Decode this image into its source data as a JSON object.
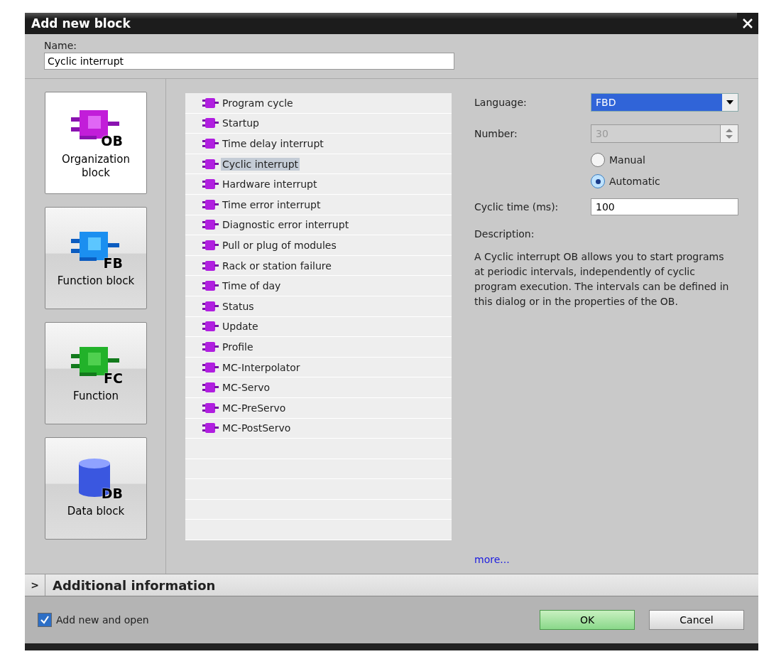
{
  "window": {
    "title": "Add new block"
  },
  "name_field": {
    "label": "Name:",
    "value": "Cyclic interrupt"
  },
  "block_types": [
    {
      "kind": "ob",
      "icon_label": "OB",
      "label": "Organization block",
      "selected": true
    },
    {
      "kind": "fb",
      "icon_label": "FB",
      "label": "Function block",
      "selected": false
    },
    {
      "kind": "fc",
      "icon_label": "FC",
      "label": "Function",
      "selected": false
    },
    {
      "kind": "db",
      "icon_label": "DB",
      "label": "Data block",
      "selected": false
    }
  ],
  "ob_types": [
    {
      "label": "Program cycle",
      "selected": false
    },
    {
      "label": "Startup",
      "selected": false
    },
    {
      "label": "Time delay interrupt",
      "selected": false
    },
    {
      "label": "Cyclic interrupt",
      "selected": true
    },
    {
      "label": "Hardware interrupt",
      "selected": false
    },
    {
      "label": "Time error interrupt",
      "selected": false
    },
    {
      "label": "Diagnostic error interrupt",
      "selected": false
    },
    {
      "label": "Pull or plug of modules",
      "selected": false
    },
    {
      "label": "Rack or station failure",
      "selected": false
    },
    {
      "label": "Time of day",
      "selected": false
    },
    {
      "label": "Status",
      "selected": false
    },
    {
      "label": "Update",
      "selected": false
    },
    {
      "label": "Profile",
      "selected": false
    },
    {
      "label": "MC-Interpolator",
      "selected": false
    },
    {
      "label": "MC-Servo",
      "selected": false
    },
    {
      "label": "MC-PreServo",
      "selected": false
    },
    {
      "label": "MC-PostServo",
      "selected": false
    }
  ],
  "properties": {
    "language": {
      "label": "Language:",
      "value": "FBD"
    },
    "number": {
      "label": "Number:",
      "value": "30",
      "disabled": true
    },
    "numbering": [
      {
        "label": "Manual",
        "selected": false
      },
      {
        "label": "Automatic",
        "selected": true
      }
    ],
    "cyclic_time": {
      "label": "Cyclic time (ms):",
      "value": "100"
    },
    "description_label": "Description:",
    "description": "A Cyclic interrupt OB allows you to start programs at periodic intervals, independently of cyclic program execution. The intervals can be defined in this dialog or in the properties of the OB.",
    "more_link": "more..."
  },
  "additional_information": {
    "label": "Additional information",
    "expanded": false,
    "toggle": ">"
  },
  "footer": {
    "add_new_and_open": {
      "label": "Add new and open",
      "checked": true
    },
    "buttons": [
      {
        "kind": "ok",
        "label": "OK"
      },
      {
        "kind": "cancel",
        "label": "Cancel"
      }
    ]
  }
}
